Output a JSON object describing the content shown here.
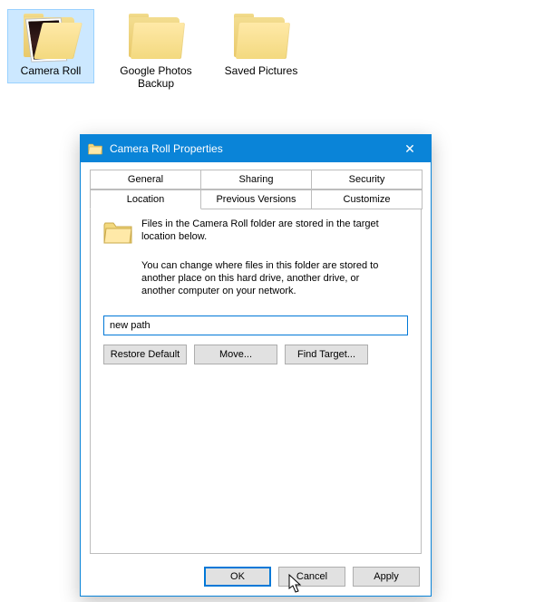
{
  "explorer": {
    "items": [
      {
        "label": "Camera Roll",
        "selected": true,
        "variant": "camera"
      },
      {
        "label": "Google Photos Backup",
        "selected": false,
        "variant": "folder"
      },
      {
        "label": "Saved Pictures",
        "selected": false,
        "variant": "folder"
      }
    ]
  },
  "dialog": {
    "title": "Camera Roll Properties",
    "close_glyph": "✕",
    "tabs_back": [
      "General",
      "Sharing",
      "Security"
    ],
    "tabs_front": [
      "Location",
      "Previous Versions",
      "Customize"
    ],
    "active_tab": "Location",
    "intro": "Files in the Camera Roll folder are stored in the target location below.",
    "paragraph": "You can change where files in this folder are stored to another place on this hard drive, another drive, or another computer on your network.",
    "path_value": "new path",
    "buttons": {
      "restore": "Restore Default",
      "move": "Move...",
      "find": "Find Target..."
    },
    "footer": {
      "ok": "OK",
      "cancel": "Cancel",
      "apply": "Apply"
    }
  }
}
